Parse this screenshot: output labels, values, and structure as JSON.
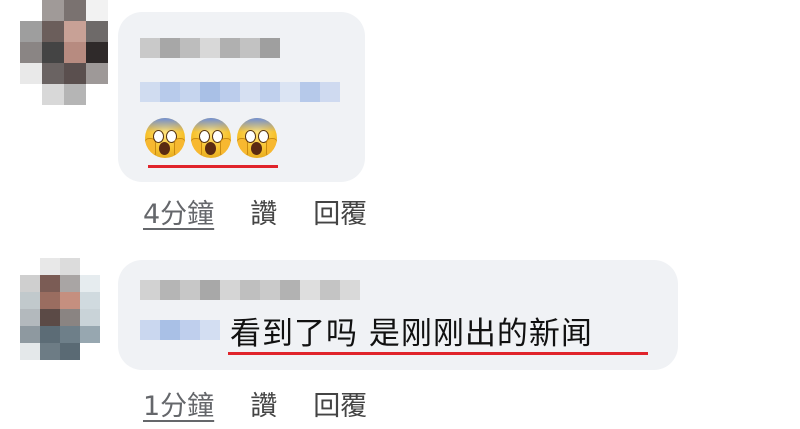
{
  "comments": [
    {
      "reactions": [
        "face-screaming-in-fear",
        "face-screaming-in-fear",
        "face-screaming-in-fear"
      ],
      "time": "4分鐘",
      "like_label": "讚",
      "reply_label": "回覆"
    },
    {
      "text": "看到了吗 是刚刚出的新闻",
      "time": "1分鐘",
      "like_label": "讚",
      "reply_label": "回覆"
    }
  ],
  "colors": {
    "bubble": "#f0f2f5",
    "underline": "#e0242b"
  }
}
